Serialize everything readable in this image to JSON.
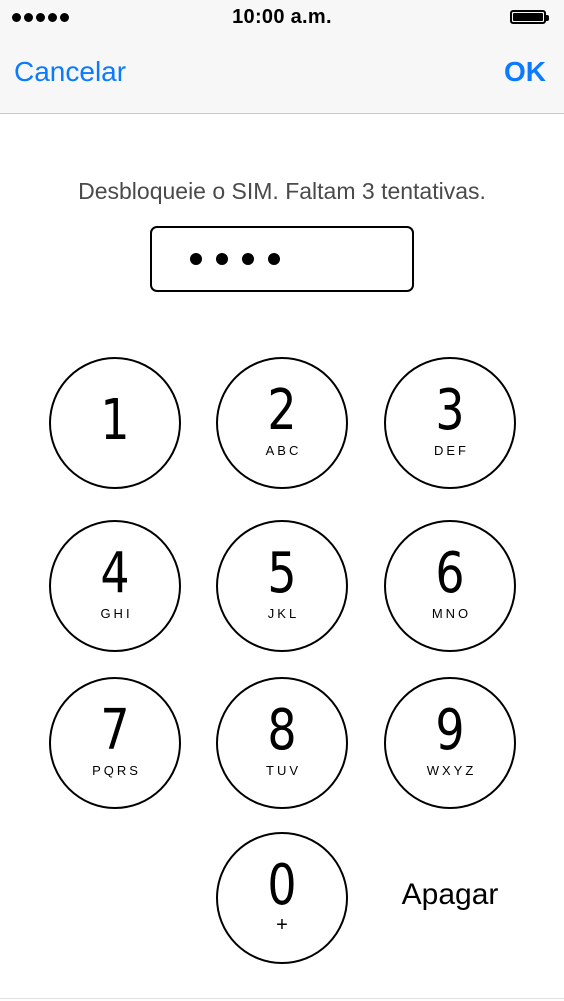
{
  "status_bar": {
    "time": "10:00 a.m.",
    "signal_icon": "signal-dots-icon",
    "battery_icon": "battery-full-icon",
    "battery_level": 1.0
  },
  "nav": {
    "cancel_label": "Cancelar",
    "ok_label": "OK",
    "accent_color": "#0a7aff"
  },
  "prompt": "Desbloqueie o SIM. Faltam 3 tentativas.",
  "pin": {
    "entered_digits": 4
  },
  "keypad": {
    "keys": [
      {
        "digit": "1",
        "letters": ""
      },
      {
        "digit": "2",
        "letters": "ABC"
      },
      {
        "digit": "3",
        "letters": "DEF"
      },
      {
        "digit": "4",
        "letters": "GHI"
      },
      {
        "digit": "5",
        "letters": "JKL"
      },
      {
        "digit": "6",
        "letters": "MNO"
      },
      {
        "digit": "7",
        "letters": "PQRS"
      },
      {
        "digit": "8",
        "letters": "TUV"
      },
      {
        "digit": "9",
        "letters": "WXYZ"
      },
      {
        "digit": "0",
        "letters": "+"
      }
    ],
    "delete_label": "Apagar"
  }
}
